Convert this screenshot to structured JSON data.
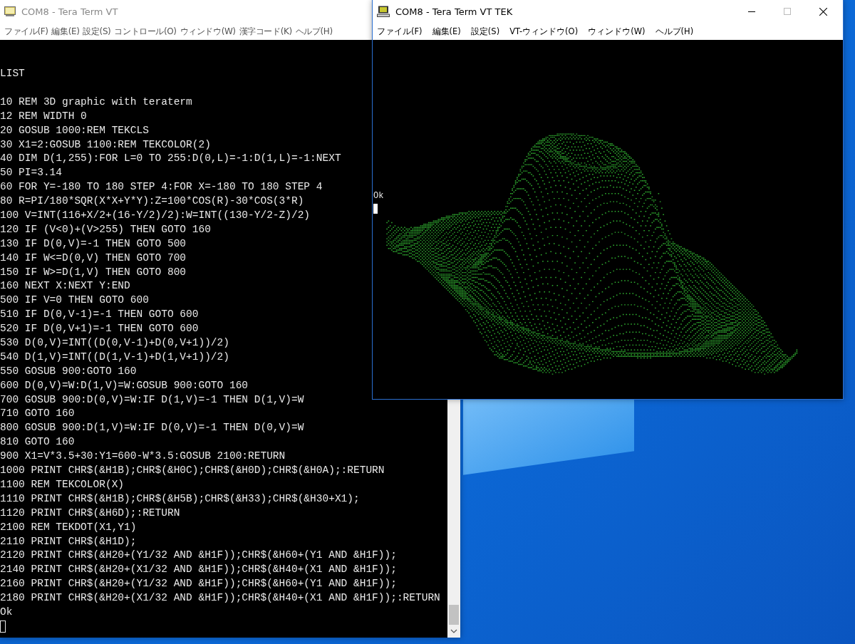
{
  "vt_window": {
    "title": "COM8 - Tera Term VT",
    "active": false,
    "menu": [
      "ファイル(F)",
      "編集(E)",
      "設定(S)",
      "コントロール(O)",
      "ウィンドウ(W)",
      "漢字コード(K)",
      "ヘルプ(H)"
    ],
    "command": "LIST",
    "listing": [
      "10 REM 3D graphic with teraterm",
      "12 REM WIDTH 0",
      "20 GOSUB 1000:REM TEKCLS",
      "30 X1=2:GOSUB 1100:REM TEKCOLOR(2)",
      "40 DIM D(1,255):FOR L=0 TO 255:D(0,L)=-1:D(1,L)=-1:NEXT",
      "50 PI=3.14",
      "60 FOR Y=-180 TO 180 STEP 4:FOR X=-180 TO 180 STEP 4",
      "80 R=PI/180*SQR(X*X+Y*Y):Z=100*COS(R)-30*COS(3*R)",
      "100 V=INT(116+X/2+(16-Y/2)/2):W=INT((130-Y/2-Z)/2)",
      "120 IF (V<0)+(V>255) THEN GOTO 160",
      "130 IF D(0,V)=-1 THEN GOTO 500",
      "140 IF W<=D(0,V) THEN GOTO 700",
      "150 IF W>=D(1,V) THEN GOTO 800",
      "160 NEXT X:NEXT Y:END",
      "500 IF V=0 THEN GOTO 600",
      "510 IF D(0,V-1)=-1 THEN GOTO 600",
      "520 IF D(0,V+1)=-1 THEN GOTO 600",
      "530 D(0,V)=INT((D(0,V-1)+D(0,V+1))/2)",
      "540 D(1,V)=INT((D(1,V-1)+D(1,V+1))/2)",
      "550 GOSUB 900:GOTO 160",
      "600 D(0,V)=W:D(1,V)=W:GOSUB 900:GOTO 160",
      "700 GOSUB 900:D(0,V)=W:IF D(1,V)=-1 THEN D(1,V)=W",
      "710 GOTO 160",
      "800 GOSUB 900:D(1,V)=W:IF D(0,V)=-1 THEN D(0,V)=W",
      "810 GOTO 160",
      "900 X1=V*3.5+30:Y1=600-W*3.5:GOSUB 2100:RETURN",
      "1000 PRINT CHR$(&H1B);CHR$(&H0C);CHR$(&H0D);CHR$(&H0A);:RETURN",
      "1100 REM TEKCOLOR(X)",
      "1110 PRINT CHR$(&H1B);CHR$(&H5B);CHR$(&H33);CHR$(&H30+X1);",
      "1120 PRINT CHR$(&H6D);:RETURN",
      "2100 REM TEKDOT(X1,Y1)",
      "2110 PRINT CHR$(&H1D);",
      "2120 PRINT CHR$(&H20+(Y1/32 AND &H1F));CHR$(&H60+(Y1 AND &H1F));",
      "2140 PRINT CHR$(&H20+(X1/32 AND &H1F));CHR$(&H40+(X1 AND &H1F));",
      "2160 PRINT CHR$(&H20+(Y1/32 AND &H1F));CHR$(&H60+(Y1 AND &H1F));",
      "2180 PRINT CHR$(&H20+(X1/32 AND &H1F));CHR$(&H40+(X1 AND &H1F));:RETURN"
    ],
    "prompt": "Ok"
  },
  "tek_window": {
    "title": "COM8 - Tera Term VT TEK",
    "active": true,
    "menu": [
      "ファイル(F)",
      "編集(E)",
      "設定(S)",
      "VT-ウィンドウ(O)",
      "ウィンドウ(W)",
      "ヘルプ(H)"
    ],
    "prompt": "Ok"
  }
}
